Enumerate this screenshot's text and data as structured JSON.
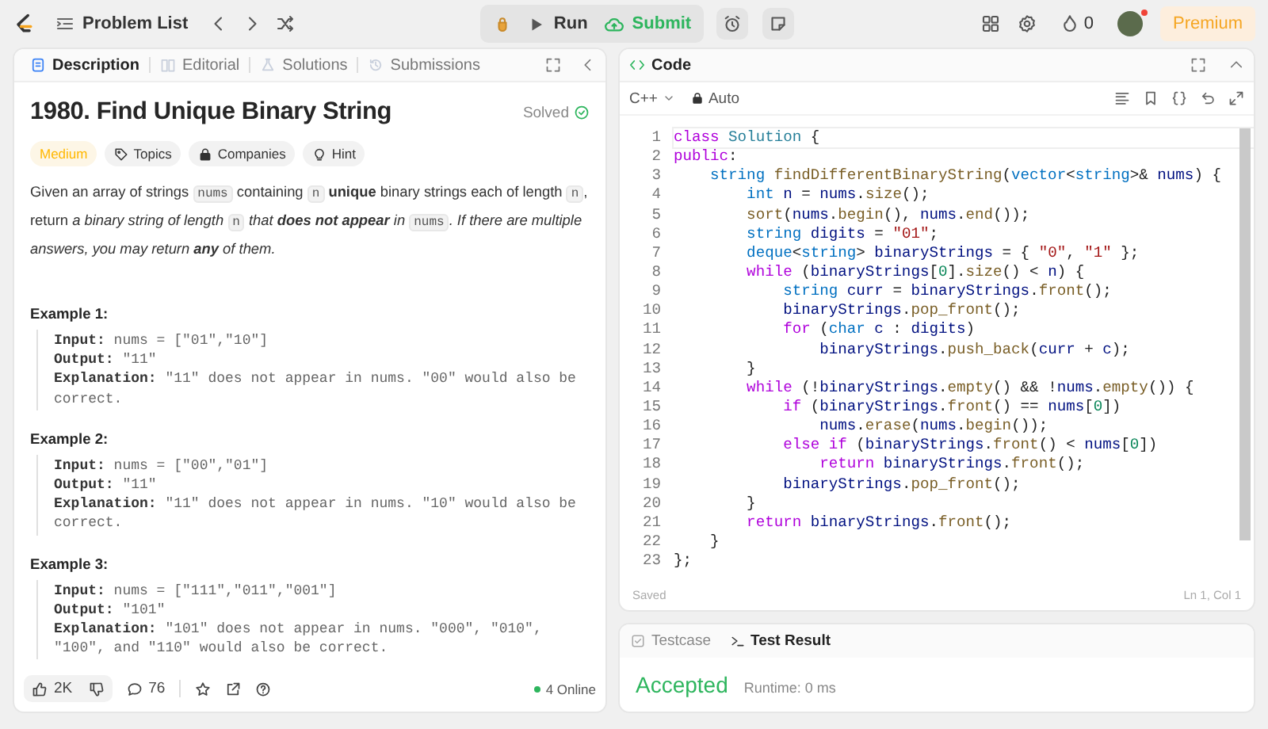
{
  "topbar": {
    "problem_list": "Problem List",
    "run": "Run",
    "submit": "Submit",
    "streak": "0",
    "notification": true,
    "premium": "Premium"
  },
  "description": {
    "tabs": [
      {
        "label": "Description",
        "selected": true
      },
      {
        "label": "Editorial",
        "selected": false
      },
      {
        "label": "Solutions",
        "selected": false
      },
      {
        "label": "Submissions",
        "selected": false
      }
    ],
    "title": "1980. Find Unique Binary String",
    "status": "Solved",
    "difficulty": "Medium",
    "tags": [
      "Topics",
      "Companies",
      "Hint"
    ],
    "paragraph": [
      {
        "kind": "text",
        "text": "Given an array of strings "
      },
      {
        "kind": "code",
        "text": "nums"
      },
      {
        "kind": "text",
        "text": " containing "
      },
      {
        "kind": "code",
        "text": "n"
      },
      {
        "kind": "bold",
        "text": " unique"
      },
      {
        "kind": "text",
        "text": " binary strings each of length "
      },
      {
        "kind": "code",
        "text": "n"
      },
      {
        "kind": "text",
        "text": ", return "
      },
      {
        "kind": "italic",
        "text": "a binary string of length "
      },
      {
        "kind": "code",
        "text": "n"
      },
      {
        "kind": "italic",
        "text": " that "
      },
      {
        "kind": "bolditalic",
        "text": "does not appear"
      },
      {
        "kind": "italic",
        "text": " in "
      },
      {
        "kind": "code",
        "text": "nums"
      },
      {
        "kind": "italic",
        "text": ". If there are multiple answers, you may return "
      },
      {
        "kind": "bolditalic",
        "text": "any"
      },
      {
        "kind": "italic",
        "text": " of them."
      }
    ],
    "examples": [
      {
        "title": "Example 1:",
        "lines": [
          {
            "label": "Input:",
            "value": "nums = [\"01\",\"10\"]"
          },
          {
            "label": "Output:",
            "value": "\"11\""
          },
          {
            "label": "Explanation:",
            "value": "\"11\" does not appear in nums. \"00\" would also be correct."
          }
        ]
      },
      {
        "title": "Example 2:",
        "lines": [
          {
            "label": "Input:",
            "value": "nums = [\"00\",\"01\"]"
          },
          {
            "label": "Output:",
            "value": "\"11\""
          },
          {
            "label": "Explanation:",
            "value": "\"11\" does not appear in nums. \"10\" would also be correct."
          }
        ]
      },
      {
        "title": "Example 3:",
        "lines": [
          {
            "label": "Input:",
            "value": "nums = [\"111\",\"011\",\"001\"]"
          },
          {
            "label": "Output:",
            "value": "\"101\""
          },
          {
            "label": "Explanation:",
            "value": "\"101\" does not appear in nums. \"000\", \"010\", \"100\", and \"110\" would also be correct."
          }
        ]
      }
    ],
    "likes": "2K",
    "comments": "76",
    "online": "4 Online"
  },
  "editor": {
    "title": "Code",
    "language": "C++",
    "mode": "Auto",
    "lines": [
      {
        "no": "1",
        "tokens": [
          {
            "kind": "kw",
            "text": "class"
          },
          {
            "kind": "cls",
            "text": " Solution"
          },
          {
            "kind": "txt",
            "text": " {"
          }
        ]
      },
      {
        "no": "2",
        "tokens": [
          {
            "kind": "kw",
            "text": "public"
          },
          {
            "kind": "txt",
            "text": ":"
          }
        ]
      },
      {
        "no": "3",
        "tokens": [
          {
            "kind": "type",
            "text": "    string"
          },
          {
            "kind": "fn",
            "text": " findDifferentBinaryString"
          },
          {
            "kind": "txt",
            "text": "("
          },
          {
            "kind": "type",
            "text": "vector"
          },
          {
            "kind": "txt",
            "text": "<"
          },
          {
            "kind": "type",
            "text": "string"
          },
          {
            "kind": "txt",
            "text": ">&"
          },
          {
            "kind": "var",
            "text": " nums"
          },
          {
            "kind": "txt",
            "text": ") {"
          }
        ]
      },
      {
        "no": "4",
        "tokens": [
          {
            "kind": "type",
            "text": "        int"
          },
          {
            "kind": "var",
            "text": " n"
          },
          {
            "kind": "txt",
            "text": " ="
          },
          {
            "kind": "var",
            "text": " nums"
          },
          {
            "kind": "txt",
            "text": "."
          },
          {
            "kind": "fn",
            "text": "size"
          },
          {
            "kind": "txt",
            "text": "();"
          }
        ]
      },
      {
        "no": "5",
        "tokens": [
          {
            "kind": "fn",
            "text": "        sort"
          },
          {
            "kind": "txt",
            "text": "("
          },
          {
            "kind": "var",
            "text": "nums"
          },
          {
            "kind": "txt",
            "text": "."
          },
          {
            "kind": "fn",
            "text": "begin"
          },
          {
            "kind": "txt",
            "text": "(),"
          },
          {
            "kind": "var",
            "text": " nums"
          },
          {
            "kind": "txt",
            "text": "."
          },
          {
            "kind": "fn",
            "text": "end"
          },
          {
            "kind": "txt",
            "text": "());"
          }
        ]
      },
      {
        "no": "6",
        "tokens": [
          {
            "kind": "type",
            "text": "        string"
          },
          {
            "kind": "var",
            "text": " digits"
          },
          {
            "kind": "txt",
            "text": " ="
          },
          {
            "kind": "str",
            "text": " \"01\""
          },
          {
            "kind": "txt",
            "text": ";"
          }
        ]
      },
      {
        "no": "7",
        "tokens": [
          {
            "kind": "type",
            "text": "        deque"
          },
          {
            "kind": "txt",
            "text": "<"
          },
          {
            "kind": "type",
            "text": "string"
          },
          {
            "kind": "txt",
            "text": ">"
          },
          {
            "kind": "var",
            "text": " binaryStrings"
          },
          {
            "kind": "txt",
            "text": " = {"
          },
          {
            "kind": "str",
            "text": " \"0\""
          },
          {
            "kind": "txt",
            "text": ","
          },
          {
            "kind": "str",
            "text": " \"1\""
          },
          {
            "kind": "txt",
            "text": " };"
          }
        ]
      },
      {
        "no": "8",
        "tokens": [
          {
            "kind": "kw",
            "text": "        while"
          },
          {
            "kind": "txt",
            "text": " ("
          },
          {
            "kind": "var",
            "text": "binaryStrings"
          },
          {
            "kind": "txt",
            "text": "["
          },
          {
            "kind": "num",
            "text": "0"
          },
          {
            "kind": "txt",
            "text": "]."
          },
          {
            "kind": "fn",
            "text": "size"
          },
          {
            "kind": "txt",
            "text": "() <"
          },
          {
            "kind": "var",
            "text": " n"
          },
          {
            "kind": "txt",
            "text": ") {"
          }
        ]
      },
      {
        "no": "9",
        "tokens": [
          {
            "kind": "type",
            "text": "            string"
          },
          {
            "kind": "var",
            "text": " curr"
          },
          {
            "kind": "txt",
            "text": " ="
          },
          {
            "kind": "var",
            "text": " binaryStrings"
          },
          {
            "kind": "txt",
            "text": "."
          },
          {
            "kind": "fn",
            "text": "front"
          },
          {
            "kind": "txt",
            "text": "();"
          }
        ]
      },
      {
        "no": "10",
        "tokens": [
          {
            "kind": "var",
            "text": "            binaryStrings"
          },
          {
            "kind": "txt",
            "text": "."
          },
          {
            "kind": "fn",
            "text": "pop_front"
          },
          {
            "kind": "txt",
            "text": "();"
          }
        ]
      },
      {
        "no": "11",
        "tokens": [
          {
            "kind": "kw",
            "text": "            for"
          },
          {
            "kind": "txt",
            "text": " ("
          },
          {
            "kind": "type",
            "text": "char"
          },
          {
            "kind": "var",
            "text": " c"
          },
          {
            "kind": "txt",
            "text": " :"
          },
          {
            "kind": "var",
            "text": " digits"
          },
          {
            "kind": "txt",
            "text": ")"
          }
        ]
      },
      {
        "no": "12",
        "tokens": [
          {
            "kind": "var",
            "text": "                binaryStrings"
          },
          {
            "kind": "txt",
            "text": "."
          },
          {
            "kind": "fn",
            "text": "push_back"
          },
          {
            "kind": "txt",
            "text": "("
          },
          {
            "kind": "var",
            "text": "curr"
          },
          {
            "kind": "txt",
            "text": " +"
          },
          {
            "kind": "var",
            "text": " c"
          },
          {
            "kind": "txt",
            "text": ");"
          }
        ]
      },
      {
        "no": "13",
        "tokens": [
          {
            "kind": "txt",
            "text": "        }"
          }
        ]
      },
      {
        "no": "14",
        "tokens": [
          {
            "kind": "kw",
            "text": "        while"
          },
          {
            "kind": "txt",
            "text": " (!"
          },
          {
            "kind": "var",
            "text": "binaryStrings"
          },
          {
            "kind": "txt",
            "text": "."
          },
          {
            "kind": "fn",
            "text": "empty"
          },
          {
            "kind": "txt",
            "text": "() && !"
          },
          {
            "kind": "var",
            "text": "nums"
          },
          {
            "kind": "txt",
            "text": "."
          },
          {
            "kind": "fn",
            "text": "empty"
          },
          {
            "kind": "txt",
            "text": "()) {"
          }
        ]
      },
      {
        "no": "15",
        "tokens": [
          {
            "kind": "kw",
            "text": "            if"
          },
          {
            "kind": "txt",
            "text": " ("
          },
          {
            "kind": "var",
            "text": "binaryStrings"
          },
          {
            "kind": "txt",
            "text": "."
          },
          {
            "kind": "fn",
            "text": "front"
          },
          {
            "kind": "txt",
            "text": "() =="
          },
          {
            "kind": "var",
            "text": " nums"
          },
          {
            "kind": "txt",
            "text": "["
          },
          {
            "kind": "num",
            "text": "0"
          },
          {
            "kind": "txt",
            "text": "])"
          }
        ]
      },
      {
        "no": "16",
        "tokens": [
          {
            "kind": "var",
            "text": "                nums"
          },
          {
            "kind": "txt",
            "text": "."
          },
          {
            "kind": "fn",
            "text": "erase"
          },
          {
            "kind": "txt",
            "text": "("
          },
          {
            "kind": "var",
            "text": "nums"
          },
          {
            "kind": "txt",
            "text": "."
          },
          {
            "kind": "fn",
            "text": "begin"
          },
          {
            "kind": "txt",
            "text": "());"
          }
        ]
      },
      {
        "no": "17",
        "tokens": [
          {
            "kind": "kw",
            "text": "            else if"
          },
          {
            "kind": "txt",
            "text": " ("
          },
          {
            "kind": "var",
            "text": "binaryStrings"
          },
          {
            "kind": "txt",
            "text": "."
          },
          {
            "kind": "fn",
            "text": "front"
          },
          {
            "kind": "txt",
            "text": "() <"
          },
          {
            "kind": "var",
            "text": " nums"
          },
          {
            "kind": "txt",
            "text": "["
          },
          {
            "kind": "num",
            "text": "0"
          },
          {
            "kind": "txt",
            "text": "])"
          }
        ]
      },
      {
        "no": "18",
        "tokens": [
          {
            "kind": "kw",
            "text": "                return"
          },
          {
            "kind": "var",
            "text": " binaryStrings"
          },
          {
            "kind": "txt",
            "text": "."
          },
          {
            "kind": "fn",
            "text": "front"
          },
          {
            "kind": "txt",
            "text": "();"
          }
        ]
      },
      {
        "no": "19",
        "tokens": [
          {
            "kind": "var",
            "text": "            binaryStrings"
          },
          {
            "kind": "txt",
            "text": "."
          },
          {
            "kind": "fn",
            "text": "pop_front"
          },
          {
            "kind": "txt",
            "text": "();"
          }
        ]
      },
      {
        "no": "20",
        "tokens": [
          {
            "kind": "txt",
            "text": "        }"
          }
        ]
      },
      {
        "no": "21",
        "tokens": [
          {
            "kind": "kw",
            "text": "        return"
          },
          {
            "kind": "var",
            "text": " binaryStrings"
          },
          {
            "kind": "txt",
            "text": "."
          },
          {
            "kind": "fn",
            "text": "front"
          },
          {
            "kind": "txt",
            "text": "();"
          }
        ]
      },
      {
        "no": "22",
        "tokens": [
          {
            "kind": "txt",
            "text": "    }"
          }
        ]
      },
      {
        "no": "23",
        "tokens": [
          {
            "kind": "txt",
            "text": "};"
          }
        ]
      }
    ],
    "save_status": "Saved",
    "cursor": "Ln 1, Col 1"
  },
  "result": {
    "tabs": [
      {
        "label": "Testcase",
        "selected": false
      },
      {
        "label": "Test Result",
        "selected": true
      }
    ],
    "verdict": "Accepted",
    "runtime": "Runtime: 0 ms"
  }
}
